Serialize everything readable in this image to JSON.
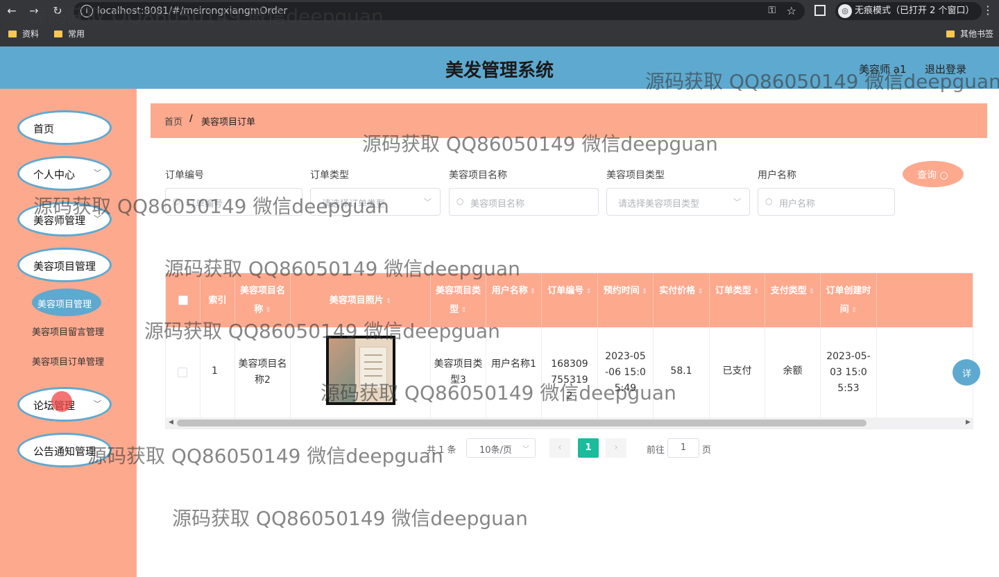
{
  "browser": {
    "url": "localhost:8081/#/meirongxiangmOrder",
    "incognito_label": "无痕模式（已打开 2 个窗口）",
    "bookmarks": [
      "资料",
      "常用"
    ],
    "other_bookmarks": "其他书签"
  },
  "header": {
    "title": "美发管理系统",
    "user": "美容师 a1",
    "logout": "退出登录"
  },
  "sidebar": {
    "items": [
      {
        "label": "首页"
      },
      {
        "label": "个人中心"
      },
      {
        "label": "美容师管理"
      },
      {
        "label": "美容项目管理"
      },
      {
        "label": "论坛管理"
      },
      {
        "label": "公告通知管理"
      }
    ],
    "sub_items": [
      {
        "label": "美容项目管理"
      },
      {
        "label": "美容项目留言管理"
      },
      {
        "label": "美容项目订单管理"
      }
    ]
  },
  "breadcrumb": {
    "home": "首页",
    "separator": "/",
    "current": "美容项目订单"
  },
  "filters": {
    "order_no_label": "订单编号",
    "order_no_placeholder": "订单编号",
    "order_type_label": "订单类型",
    "order_type_placeholder": "请选择订单类型",
    "item_name_label": "美容项目名称",
    "item_name_placeholder": "美容项目名称",
    "item_type_label": "美容项目类型",
    "item_type_placeholder": "请选择美容项目类型",
    "user_name_label": "用户名称",
    "user_name_placeholder": "用户名称",
    "query_button": "查询"
  },
  "table": {
    "headers": {
      "index": "索引",
      "item_name": "美容项目名称",
      "item_photo": "美容项目照片",
      "item_type": "美容项目类型",
      "user_name": "用户名称",
      "order_no": "订单编号",
      "appointment_time": "预约时间",
      "paid_price": "实付价格",
      "order_type": "订单类型",
      "pay_type": "支付类型",
      "created_time": "订单创建时间"
    },
    "rows": [
      {
        "index": "1",
        "item_name": "美容项目名称2",
        "item_type": "美容项目类型3",
        "user_name": "用户名称1",
        "order_no": "1683097553192",
        "appointment_time": "2023-05-06 15:05:49",
        "paid_price": "58.1",
        "order_type": "已支付",
        "pay_type": "余额",
        "created_time": "2023-05-03 15:05:53",
        "action": "详"
      }
    ]
  },
  "pagination": {
    "total": "共 1 条",
    "page_size": "10条/页",
    "prev": "‹",
    "current_page": "1",
    "next": "›",
    "goto_label": "前往",
    "goto_value": "1",
    "page_suffix": "页"
  },
  "watermark": "源码获取 QQ86050149 微信deepguan",
  "colors": {
    "header_blue": "#5ea9cf",
    "salmon": "#fca98e",
    "page_active": "#1abc9c"
  }
}
